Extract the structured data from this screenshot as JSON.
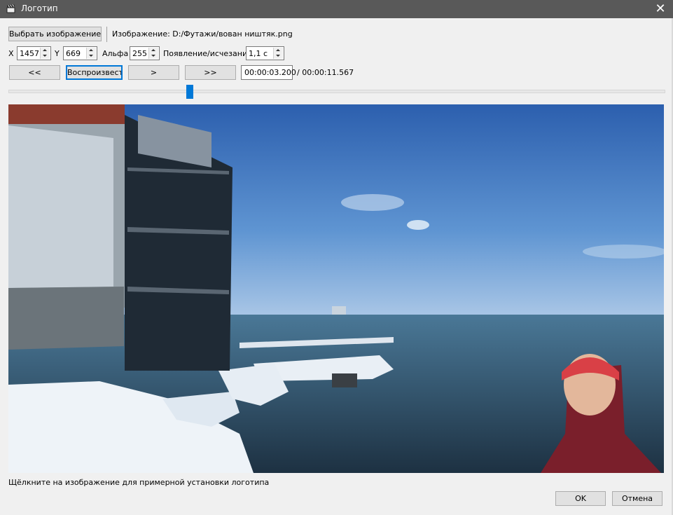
{
  "window": {
    "title": "Логотип",
    "close_glyph": "✕"
  },
  "toolbar": {
    "choose_image_label": "Выбрать изображение...",
    "image_path_text": "Изображение: D:/Футажи/вован ништяк.png"
  },
  "position": {
    "x_label": "X",
    "x_value": "1457",
    "y_label": "Y",
    "y_value": "669",
    "alpha_label": "Альфа",
    "alpha_value": "255",
    "fade_label": "Появление/исчезание",
    "fade_value": "1,1 с"
  },
  "playback": {
    "rewind_label": "<<",
    "play_label": "Воспроизвести",
    "step_label": ">",
    "forward_label": ">>",
    "current_time": "00:00:03.200",
    "total_time": "/ 00:00:11.567",
    "slider_position_fraction": 0.277
  },
  "preview": {
    "hint": "Щёлкните на изображение для примерной установки логотипа"
  },
  "dialog": {
    "ok_label": "OK",
    "cancel_label": "Отмена"
  },
  "colors": {
    "accent": "#0078d7",
    "titlebar": "#595959"
  }
}
